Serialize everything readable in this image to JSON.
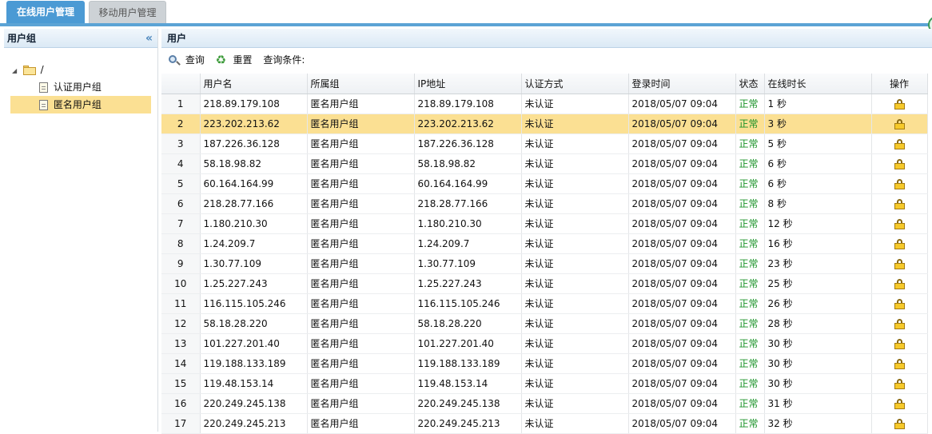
{
  "tabs": [
    {
      "label": "在线用户管理"
    },
    {
      "label": "移动用户管理"
    }
  ],
  "left_panel": {
    "title": "用户组",
    "collapse_icon": "«",
    "tree": {
      "root_label": "/",
      "children": [
        {
          "label": "认证用户组"
        },
        {
          "label": "匿名用户组"
        }
      ]
    }
  },
  "right_panel": {
    "title": "用户",
    "toolbar": {
      "search_label": "查询",
      "reset_label": "重置",
      "condition_label": "查询条件:"
    },
    "columns": [
      "用户名",
      "所属组",
      "IP地址",
      "认证方式",
      "登录时间",
      "状态",
      "在线时长",
      "操作"
    ],
    "rows": [
      {
        "n": "1",
        "user": "218.89.179.108",
        "group": "匿名用户组",
        "ip": "218.89.179.108",
        "auth": "未认证",
        "time": "2018/05/07 09:04",
        "status": "正常",
        "dur": "1 秒"
      },
      {
        "n": "2",
        "user": "223.202.213.62",
        "group": "匿名用户组",
        "ip": "223.202.213.62",
        "auth": "未认证",
        "time": "2018/05/07 09:04",
        "status": "正常",
        "dur": "3 秒"
      },
      {
        "n": "3",
        "user": "187.226.36.128",
        "group": "匿名用户组",
        "ip": "187.226.36.128",
        "auth": "未认证",
        "time": "2018/05/07 09:04",
        "status": "正常",
        "dur": "5 秒"
      },
      {
        "n": "4",
        "user": "58.18.98.82",
        "group": "匿名用户组",
        "ip": "58.18.98.82",
        "auth": "未认证",
        "time": "2018/05/07 09:04",
        "status": "正常",
        "dur": "6 秒"
      },
      {
        "n": "5",
        "user": "60.164.164.99",
        "group": "匿名用户组",
        "ip": "60.164.164.99",
        "auth": "未认证",
        "time": "2018/05/07 09:04",
        "status": "正常",
        "dur": "6 秒"
      },
      {
        "n": "6",
        "user": "218.28.77.166",
        "group": "匿名用户组",
        "ip": "218.28.77.166",
        "auth": "未认证",
        "time": "2018/05/07 09:04",
        "status": "正常",
        "dur": "8 秒"
      },
      {
        "n": "7",
        "user": "1.180.210.30",
        "group": "匿名用户组",
        "ip": "1.180.210.30",
        "auth": "未认证",
        "time": "2018/05/07 09:04",
        "status": "正常",
        "dur": "12 秒"
      },
      {
        "n": "8",
        "user": "1.24.209.7",
        "group": "匿名用户组",
        "ip": "1.24.209.7",
        "auth": "未认证",
        "time": "2018/05/07 09:04",
        "status": "正常",
        "dur": "16 秒"
      },
      {
        "n": "9",
        "user": "1.30.77.109",
        "group": "匿名用户组",
        "ip": "1.30.77.109",
        "auth": "未认证",
        "time": "2018/05/07 09:04",
        "status": "正常",
        "dur": "23 秒"
      },
      {
        "n": "10",
        "user": "1.25.227.243",
        "group": "匿名用户组",
        "ip": "1.25.227.243",
        "auth": "未认证",
        "time": "2018/05/07 09:04",
        "status": "正常",
        "dur": "25 秒"
      },
      {
        "n": "11",
        "user": "116.115.105.246",
        "group": "匿名用户组",
        "ip": "116.115.105.246",
        "auth": "未认证",
        "time": "2018/05/07 09:04",
        "status": "正常",
        "dur": "26 秒"
      },
      {
        "n": "12",
        "user": "58.18.28.220",
        "group": "匿名用户组",
        "ip": "58.18.28.220",
        "auth": "未认证",
        "time": "2018/05/07 09:04",
        "status": "正常",
        "dur": "28 秒"
      },
      {
        "n": "13",
        "user": "101.227.201.40",
        "group": "匿名用户组",
        "ip": "101.227.201.40",
        "auth": "未认证",
        "time": "2018/05/07 09:04",
        "status": "正常",
        "dur": "30 秒"
      },
      {
        "n": "14",
        "user": "119.188.133.189",
        "group": "匿名用户组",
        "ip": "119.188.133.189",
        "auth": "未认证",
        "time": "2018/05/07 09:04",
        "status": "正常",
        "dur": "30 秒"
      },
      {
        "n": "15",
        "user": "119.48.153.14",
        "group": "匿名用户组",
        "ip": "119.48.153.14",
        "auth": "未认证",
        "time": "2018/05/07 09:04",
        "status": "正常",
        "dur": "30 秒"
      },
      {
        "n": "16",
        "user": "220.249.245.138",
        "group": "匿名用户组",
        "ip": "220.249.245.138",
        "auth": "未认证",
        "time": "2018/05/07 09:04",
        "status": "正常",
        "dur": "31 秒"
      },
      {
        "n": "17",
        "user": "220.249.245.213",
        "group": "匿名用户组",
        "ip": "220.249.245.213",
        "auth": "未认证",
        "time": "2018/05/07 09:04",
        "status": "正常",
        "dur": "32 秒"
      }
    ],
    "selected_row": 2
  },
  "colors": {
    "accent": "#4b9ad4",
    "selection": "#fbe093",
    "status_ok": "#179125"
  },
  "icons": {
    "search": "search-icon",
    "reset": "refresh-icon",
    "action": "lock-icon",
    "folder": "folder-icon",
    "leaf": "document-icon"
  }
}
